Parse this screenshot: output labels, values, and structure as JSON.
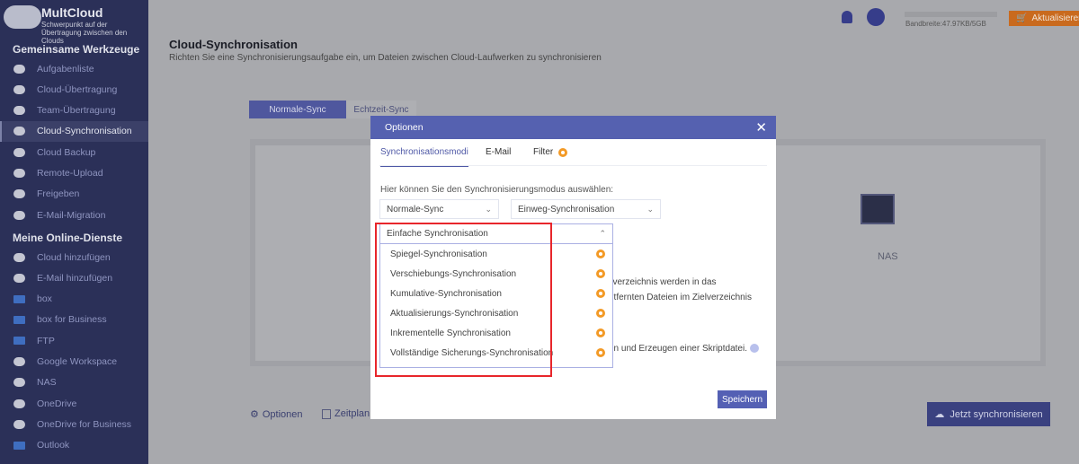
{
  "app": {
    "name": "MultCloud",
    "tagline": "Schwerpunkt auf der Übertragung zwischen den Clouds"
  },
  "sidebar": {
    "section1": "Gemeinsame Werkzeuge",
    "tools": [
      {
        "label": "Aufgabenliste",
        "icon": "clipboard-icon"
      },
      {
        "label": "Cloud-Übertragung",
        "icon": "cloud-transfer-icon"
      },
      {
        "label": "Team-Übertragung",
        "icon": "team-transfer-icon"
      },
      {
        "label": "Cloud-Synchronisation",
        "icon": "cloud-sync-icon",
        "active": true
      },
      {
        "label": "Cloud Backup",
        "icon": "cloud-backup-icon"
      },
      {
        "label": "Remote-Upload",
        "icon": "upload-icon"
      },
      {
        "label": "Freigeben",
        "icon": "share-icon"
      },
      {
        "label": "E-Mail-Migration",
        "icon": "email-migration-icon"
      }
    ],
    "section2": "Meine Online-Dienste",
    "services": [
      {
        "label": "Cloud hinzufügen",
        "icon": "cloud-add-icon"
      },
      {
        "label": "E-Mail hinzufügen",
        "icon": "email-add-icon"
      },
      {
        "label": "box",
        "icon": "box-icon"
      },
      {
        "label": "box for Business",
        "icon": "box-icon"
      },
      {
        "label": "FTP",
        "icon": "ftp-icon"
      },
      {
        "label": "Google Workspace",
        "icon": "google-icon"
      },
      {
        "label": "NAS",
        "icon": "nas-icon"
      },
      {
        "label": "OneDrive",
        "icon": "onedrive-icon"
      },
      {
        "label": "OneDrive for Business",
        "icon": "onedrive-icon"
      },
      {
        "label": "Outlook",
        "icon": "outlook-icon"
      }
    ]
  },
  "header": {
    "bandwidth": "Bandbreite:47.97KB/5GB",
    "upgrade": "Aktualisieren"
  },
  "main": {
    "title": "Cloud-Synchronisation",
    "subtitle": "Richten Sie eine Synchronisierungsaufgabe ein, um Dateien zwischen Cloud-Laufwerken zu synchronisieren",
    "tabs": [
      "Normale-Sync",
      "Echtzeit-Sync"
    ],
    "target_label": "NAS",
    "options": "Optionen",
    "schedule": "Zeitplan",
    "sync_now": "Jetzt synchronisieren"
  },
  "dialog": {
    "title": "Optionen",
    "tabs": [
      "Synchronisationsmodi",
      "E-Mail",
      "Filter"
    ],
    "prompt": "Hier können Sie den Synchronisierungsmodus auswählen:",
    "select1": "Normale-Sync",
    "select2": "Einweg-Synchronisation",
    "mode_selected": "Einfache Synchronisation",
    "mode_options": [
      "Spiegel-Synchronisation",
      "Verschiebungs-Synchronisation",
      "Kumulative-Synchronisation",
      "Aktualisierungs-Synchronisation",
      "Inkrementelle Synchronisation",
      "Vollständige Sicherungs-Synchronisation"
    ],
    "desc_frag1": "llverzeichnis werden in das",
    "desc_frag2": "ntfernten Dateien im Zielverzeichnis",
    "desc_frag3": "en und Erzeugen einer Skriptdatei.",
    "save": "Speichern"
  },
  "colors": {
    "accent": "#5561b0",
    "premium": "#f39a26",
    "highlight": "#e8262b"
  }
}
